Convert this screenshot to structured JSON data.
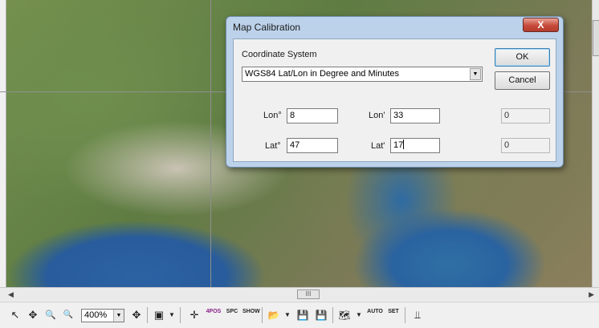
{
  "dialog": {
    "title": "Map Calibration",
    "close_glyph": "X",
    "coordinate_system_label": "Coordinate System",
    "coordinate_system_value": "WGS84 Lat/Lon in Degree and Minutes",
    "ok_label": "OK",
    "cancel_label": "Cancel",
    "lon_deg_label": "Lon°",
    "lon_deg_value": "8",
    "lon_min_label": "Lon'",
    "lon_min_value": "33",
    "lon_extra_value": "0",
    "lat_deg_label": "Lat°",
    "lat_deg_value": "47",
    "lat_min_label": "Lat'",
    "lat_min_value": "17",
    "lat_extra_value": "0"
  },
  "toolbar": {
    "zoom_value": "400%",
    "icons": {
      "pointer": "↖",
      "move": "✥",
      "zoom_in": "🔍",
      "zoom_out": "🔍",
      "fit": "✥",
      "properties": "▣",
      "crosshair": "✛",
      "pos": "4POS",
      "spc": "SPC",
      "show": "SHOW",
      "open": "📂",
      "save": "💾",
      "save_as": "💾",
      "map": "🗺",
      "auto": "AUTO",
      "set": "SET",
      "settings": "⫫"
    }
  },
  "scrollbar": {
    "thumb_grip": "III"
  }
}
